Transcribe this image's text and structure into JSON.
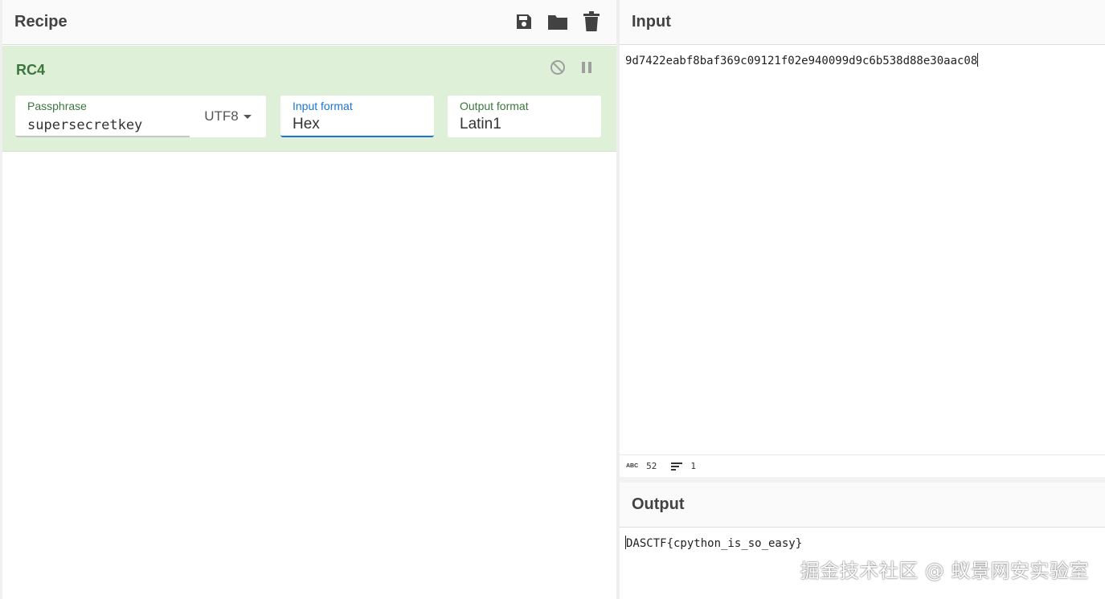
{
  "recipe": {
    "title": "Recipe",
    "actions": [
      {
        "name": "save-icon"
      },
      {
        "name": "folder-icon"
      },
      {
        "name": "trash-icon"
      }
    ],
    "operation": {
      "name": "RC4",
      "passphrase_label": "Passphrase",
      "passphrase_value": "supersecretkey",
      "passphrase_encoding": "UTF8",
      "input_format_label": "Input format",
      "input_format_value": "Hex",
      "output_format_label": "Output format",
      "output_format_value": "Latin1"
    }
  },
  "input": {
    "title": "Input",
    "text": "9d7422eabf8baf369c09121f02e940099d9c6b538d88e30aac08",
    "length": "52",
    "lines": "1"
  },
  "output": {
    "title": "Output",
    "text": "DASCTF{cpython_is_so_easy}"
  },
  "watermark": "掘金技术社区 @ 蚁景网安实验室",
  "colors": {
    "op_background": "#dff0d8",
    "op_text": "#3c763d",
    "focus_blue": "#1976d2"
  }
}
